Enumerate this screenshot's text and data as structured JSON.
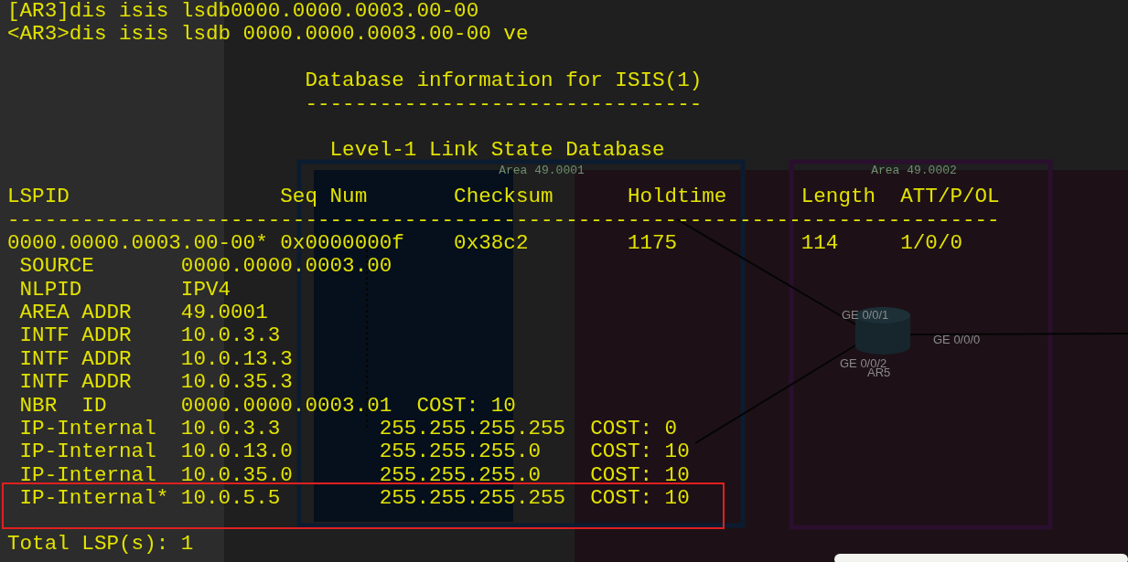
{
  "terminal": {
    "lines": [
      {
        "kind": "text",
        "text": "[AR3]dis isis lsdb0000.0000.0003.00-00",
        "highlighted": false
      },
      {
        "kind": "text",
        "text": "<AR3>dis isis lsdb 0000.0000.0003.00-00 ve",
        "highlighted": false
      },
      {
        "kind": "blank"
      },
      {
        "kind": "text",
        "text": "                        Database information for ISIS(1)",
        "highlighted": false
      },
      {
        "kind": "text",
        "text": "                        --------------------------------",
        "highlighted": false
      },
      {
        "kind": "blank"
      },
      {
        "kind": "text",
        "text": "                          Level-1 Link State Database",
        "highlighted": false
      },
      {
        "kind": "blank"
      },
      {
        "kind": "text",
        "text": "LSPID                 Seq Num       Checksum      Holdtime      Length  ATT/P/OL",
        "highlighted": false
      },
      {
        "kind": "text",
        "text": "--------------------------------------------------------------------------------",
        "highlighted": false
      },
      {
        "kind": "text",
        "text": "0000.0000.0003.00-00* 0x0000000f    0x38c2        1175          114     1/0/0",
        "highlighted": false
      },
      {
        "kind": "text",
        "text": " SOURCE       0000.0000.0003.00",
        "highlighted": false
      },
      {
        "kind": "text",
        "text": " NLPID        IPV4",
        "highlighted": false
      },
      {
        "kind": "text",
        "text": " AREA ADDR    49.0001",
        "highlighted": false
      },
      {
        "kind": "text",
        "text": " INTF ADDR    10.0.3.3",
        "highlighted": false
      },
      {
        "kind": "text",
        "text": " INTF ADDR    10.0.13.3",
        "highlighted": false
      },
      {
        "kind": "text",
        "text": " INTF ADDR    10.0.35.3",
        "highlighted": false
      },
      {
        "kind": "text",
        "text": " NBR  ID      0000.0000.0003.01  COST: 10",
        "highlighted": false
      },
      {
        "kind": "text",
        "text": " IP-Internal  10.0.3.3        255.255.255.255  COST: 0",
        "highlighted": false
      },
      {
        "kind": "text",
        "text": " IP-Internal  10.0.13.0       255.255.255.0    COST: 10",
        "highlighted": false
      },
      {
        "kind": "text",
        "text": " IP-Internal  10.0.35.0       255.255.255.0    COST: 10",
        "highlighted": false
      },
      {
        "kind": "text",
        "text": " IP-Internal* 10.0.5.5        255.255.255.255  COST: 10",
        "highlighted": true
      },
      {
        "kind": "text",
        "text": "Total LSP(s): 1",
        "highlighted": false
      }
    ]
  },
  "topology": {
    "areas": [
      {
        "label": "Area 49.0001"
      },
      {
        "label": "Area 49.0002"
      }
    ],
    "router": {
      "label": "AR5"
    },
    "ports": [
      "GE 0/0/1",
      "GE 0/0/0",
      "GE 0/0/2"
    ]
  }
}
